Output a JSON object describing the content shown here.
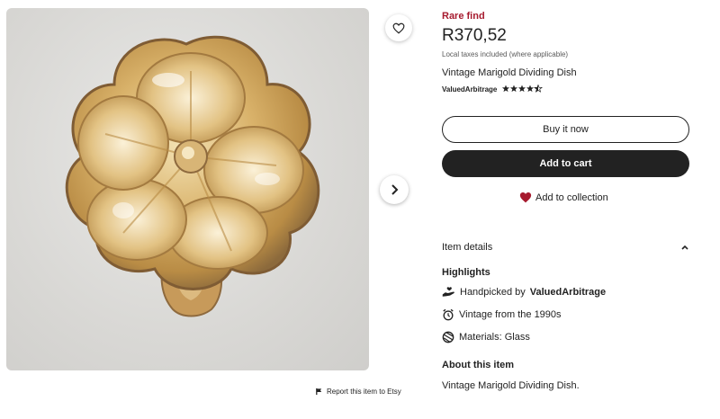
{
  "product": {
    "badge": "Rare find",
    "price": "R370,52",
    "tax_note": "Local taxes included (where applicable)",
    "title": "Vintage Marigold Dividing Dish",
    "shop_name": "ValuedArbitrage",
    "rating_stars": 4.5
  },
  "gallery": {
    "favorite_icon": "heart-outline-icon",
    "next_icon": "chevron-right-icon",
    "report_label": "Report this item to Etsy"
  },
  "actions": {
    "buy_now": "Buy it now",
    "add_to_cart": "Add to cart",
    "add_to_collection": "Add to collection"
  },
  "details": {
    "header": "Item details",
    "highlights_label": "Highlights",
    "handpicked_prefix": "Handpicked by",
    "handpicked_shop": "ValuedArbitrage",
    "vintage": "Vintage from the 1990s",
    "materials": "Materials: Glass",
    "about_label": "About this item",
    "about_text": "Vintage Marigold Dividing Dish."
  },
  "colors": {
    "rare_find": "#a61a2e",
    "button_dark": "#222222",
    "heart_filled": "#a61a2e"
  }
}
